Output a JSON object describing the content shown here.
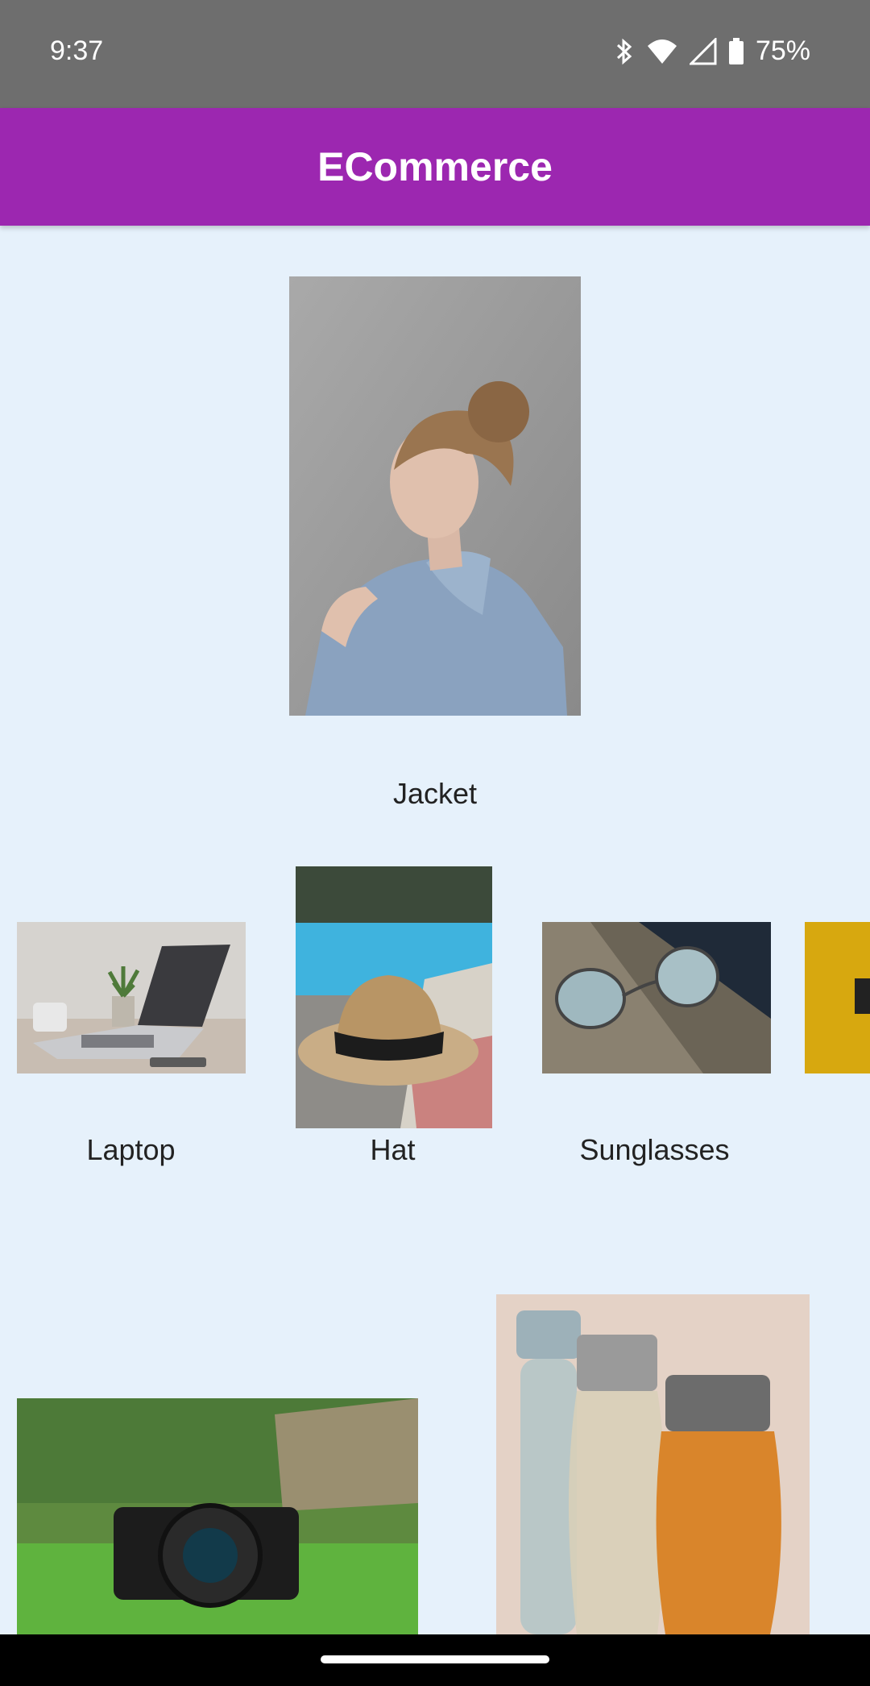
{
  "status": {
    "time": "9:37",
    "battery": "75%"
  },
  "app": {
    "title": "ECommerce"
  },
  "products": {
    "jacket": {
      "label": "Jacket"
    },
    "laptop": {
      "label": "Laptop"
    },
    "hat": {
      "label": "Hat"
    },
    "sunglasses": {
      "label": "Sunglasses"
    }
  },
  "colors": {
    "app_bar": "#9c27b0",
    "status_bar": "#6e6e6e",
    "background": "#e6f1fb"
  }
}
